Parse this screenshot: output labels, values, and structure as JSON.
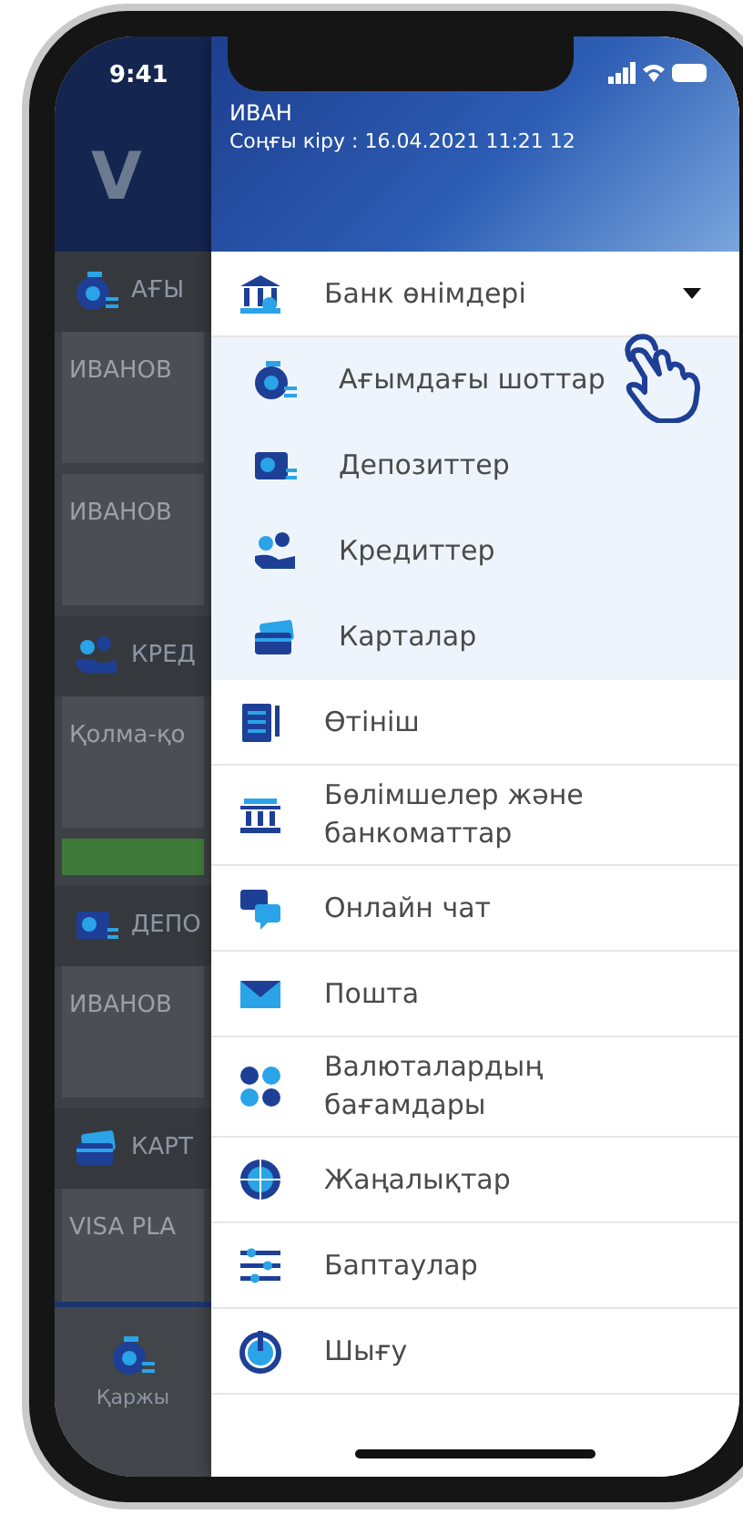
{
  "status_bar": {
    "time": "9:41"
  },
  "background_app": {
    "logo": "V",
    "sections": [
      {
        "title": "АҒЫ",
        "cards": [
          "ИВАНОВ",
          "ИВАНОВ"
        ],
        "has_button": false
      },
      {
        "title": "КРЕД",
        "cards": [
          "Қолма-қо"
        ],
        "has_button": true
      },
      {
        "title": "ДЕПО",
        "cards": [
          "ИВАНОВ"
        ],
        "has_button": false
      },
      {
        "title": "КАРТ",
        "cards": [
          "VISA PLA"
        ],
        "has_button": false
      }
    ],
    "tab_bar": {
      "label": "Қаржы"
    }
  },
  "drawer": {
    "header": {
      "name": "ИВАН",
      "last_login": "Соңғы кіру : 16.04.2021 11:21 12"
    },
    "menu": [
      {
        "label": "Банк өнімдері",
        "kind": "group",
        "expanded": true,
        "children": [
          {
            "label": "Ағымдағы шоттар",
            "pointer": true
          },
          {
            "label": "Депозиттер",
            "pointer": false
          },
          {
            "label": "Кредиттер",
            "pointer": false
          },
          {
            "label": "Карталар",
            "pointer": false
          }
        ]
      },
      {
        "label": "Өтініш",
        "kind": "item"
      },
      {
        "label": "Бөлімшелер және банкоматтар",
        "kind": "item"
      },
      {
        "label": "Онлайн чат",
        "kind": "item"
      },
      {
        "label": "Пошта",
        "kind": "item"
      },
      {
        "label": "Валюталардың бағамдары",
        "kind": "item"
      },
      {
        "label": "Жаңалықтар",
        "kind": "item"
      },
      {
        "label": "Баптаулар",
        "kind": "item"
      },
      {
        "label": "Шығу",
        "kind": "item"
      }
    ]
  }
}
